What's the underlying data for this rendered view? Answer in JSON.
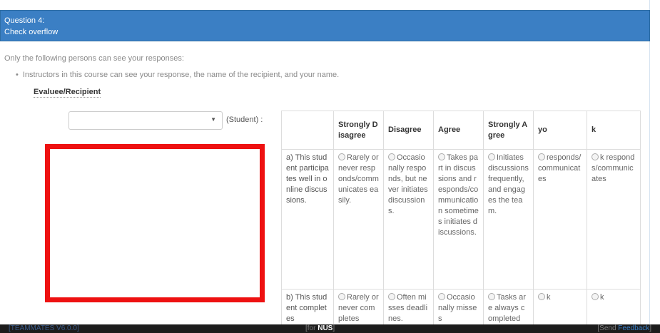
{
  "question": {
    "number_label": "Question 4:",
    "title": "Check overflow"
  },
  "visibility": {
    "intro": "Only the following persons can see your responses:",
    "items": [
      "Instructors in this course can see your response, the name of the recipient, and your name."
    ]
  },
  "evaluee_header": "Evaluee/Recipient",
  "recipient": {
    "selected": "",
    "suffix": "(Student) :"
  },
  "rubric": {
    "columns": [
      "",
      "Strongly Disagree",
      "Disagree",
      "Agree",
      "Strongly Agree",
      "yo",
      "k"
    ],
    "rows": [
      {
        "statement": "a) This student participates well in online discussions.",
        "choices": [
          "Rarely or never responds/communicates easily.",
          "Occasionally responds, but never initiates discussions.",
          "Takes part in discussions and responds/communication sometimes initiates discussions.",
          "Initiates discussions frequently, and engages the team.",
          "responds/communicates",
          "k responds/communicates"
        ]
      },
      {
        "statement": "b) This student completes",
        "choices": [
          "Rarely or never completes",
          "Often misses deadlines.",
          "Occasionally misses",
          "Tasks are always completed",
          "k",
          "k"
        ]
      }
    ]
  },
  "footer": {
    "version": "[TEAMMATES V6.0.0]",
    "org_prefix": "[for ",
    "org_name": "NUS",
    "org_suffix": "]",
    "feedback_prefix": "[Send ",
    "feedback_link": "Feedback",
    "feedback_suffix": "]"
  }
}
